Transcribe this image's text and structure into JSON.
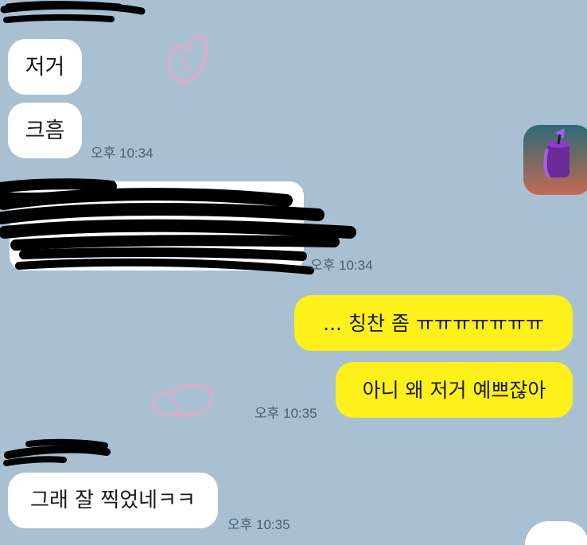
{
  "messages": {
    "m1": "저거",
    "m2": "크흠",
    "m3": "... 칭찬 좀 ㅠㅠㅠㅠㅠㅠㅠ",
    "m4": "아니 왜 저거 예쁘잖아",
    "m5": "그래 잘 찍었네ㅋㅋ"
  },
  "times": {
    "t1": "오후 10:34",
    "t2": "오후 10:34",
    "t3": "오후 10:35",
    "t4": "오후 10:35"
  },
  "colors": {
    "background": "#a9c0d2",
    "incoming_bubble": "#ffffff",
    "outgoing_bubble": "#fef01b",
    "timestamp": "#4c5e6d"
  },
  "icons": {
    "sticker": "ghost-sticker-icon",
    "avatar": "paint-bucket-avatar-icon"
  }
}
